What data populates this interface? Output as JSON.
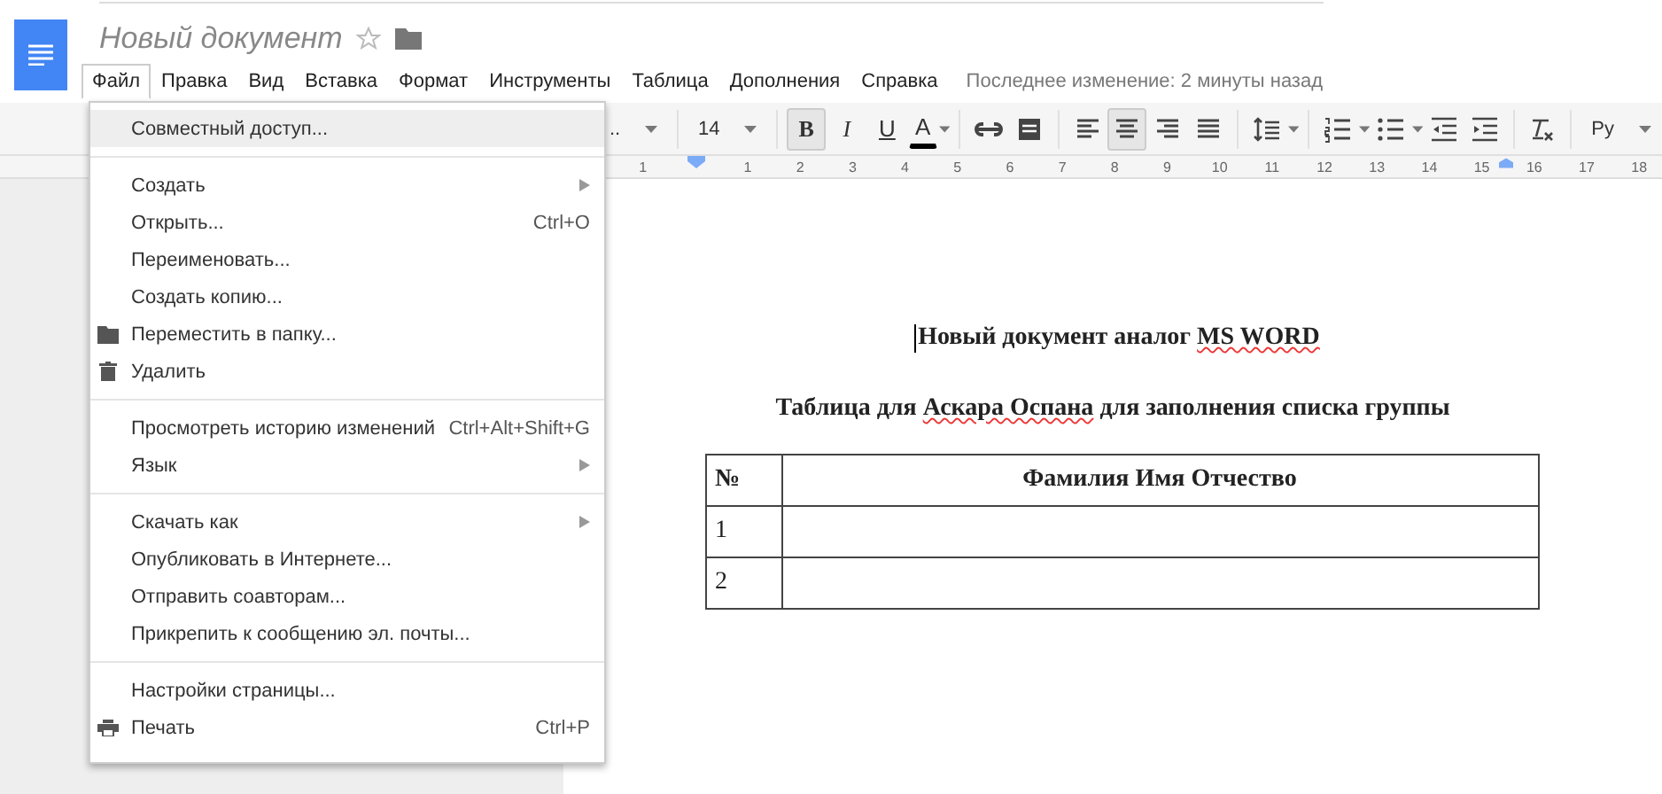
{
  "document_title": "Новый документ",
  "menubar": [
    {
      "label": "Файл",
      "selected": true
    },
    {
      "label": "Правка",
      "selected": false
    },
    {
      "label": "Вид",
      "selected": false
    },
    {
      "label": "Вставка",
      "selected": false
    },
    {
      "label": "Формат",
      "selected": false
    },
    {
      "label": "Инструменты",
      "selected": false
    },
    {
      "label": "Таблица",
      "selected": false
    },
    {
      "label": "Дополнения",
      "selected": false
    },
    {
      "label": "Справка",
      "selected": false
    }
  ],
  "last_edit": "Последнее изменение: 2 минуты назад",
  "toolbar": [
    {
      "kind": "dropdown",
      "label": ".."
    },
    {
      "kind": "separator"
    },
    {
      "kind": "dropdown",
      "label": "14"
    },
    {
      "kind": "separator"
    },
    {
      "kind": "bold",
      "label": "B",
      "selected": true
    },
    {
      "kind": "italic",
      "label": "I",
      "selected": false
    },
    {
      "kind": "underline",
      "label": "U",
      "selected": false
    },
    {
      "kind": "text-color",
      "label": "A",
      "selected": false
    },
    {
      "kind": "separator"
    },
    {
      "kind": "link",
      "selected": false
    },
    {
      "kind": "comment",
      "selected": false
    },
    {
      "kind": "separator"
    },
    {
      "kind": "align-left",
      "selected": false
    },
    {
      "kind": "align-center",
      "selected": true
    },
    {
      "kind": "align-right",
      "selected": false
    },
    {
      "kind": "align-justify",
      "selected": false
    },
    {
      "kind": "separator"
    },
    {
      "kind": "line-spacing",
      "selected": false
    },
    {
      "kind": "separator"
    },
    {
      "kind": "numbered-list",
      "selected": false
    },
    {
      "kind": "bulleted-list",
      "selected": false
    },
    {
      "kind": "indent-less",
      "selected": false
    },
    {
      "kind": "indent-more",
      "selected": false
    },
    {
      "kind": "separator"
    },
    {
      "kind": "clear-format",
      "selected": false
    },
    {
      "kind": "separator"
    },
    {
      "kind": "dropdown",
      "label": "Ру"
    }
  ],
  "ruler": [
    "1",
    "1",
    "2",
    "3",
    "4",
    "5",
    "6",
    "7",
    "8",
    "9",
    "10",
    "11",
    "12",
    "13",
    "14",
    "15",
    "16",
    "17",
    "18"
  ],
  "file_menu": [
    [
      {
        "label": "Совместный доступ...",
        "kind": "plain",
        "highlighted": true
      }
    ],
    [
      {
        "label": "Создать",
        "kind": "plain",
        "submenu": true,
        "highlighted": false
      },
      {
        "label": "Открыть...",
        "kind": "plain",
        "shortcut": "Ctrl+O",
        "highlighted": false
      },
      {
        "label": "Переименовать...",
        "kind": "plain",
        "highlighted": false
      },
      {
        "label": "Создать копию...",
        "kind": "plain",
        "highlighted": false
      },
      {
        "label": "Переместить в папку...",
        "kind": "folder",
        "highlighted": false
      },
      {
        "label": "Удалить",
        "kind": "trash",
        "highlighted": false
      }
    ],
    [
      {
        "label": "Просмотреть историю изменений",
        "kind": "plain",
        "shortcut": "Ctrl+Alt+Shift+G",
        "highlighted": false
      },
      {
        "label": "Язык",
        "kind": "plain",
        "submenu": true,
        "highlighted": false
      }
    ],
    [
      {
        "label": "Скачать как",
        "kind": "plain",
        "submenu": true,
        "highlighted": false
      },
      {
        "label": "Опубликовать в Интернете...",
        "kind": "plain",
        "highlighted": false
      },
      {
        "label": "Отправить соавторам...",
        "kind": "plain",
        "highlighted": false
      },
      {
        "label": "Прикрепить к сообщению эл. почты...",
        "kind": "plain",
        "highlighted": false
      }
    ],
    [
      {
        "label": "Настройки страницы...",
        "kind": "plain",
        "highlighted": false
      },
      {
        "label": "Печать",
        "kind": "printer",
        "shortcut": "Ctrl+P",
        "highlighted": false
      }
    ]
  ],
  "document": {
    "heading": [
      {
        "text": "Новый документ аналог ",
        "misspelled": false
      },
      {
        "text": "MS WORD",
        "misspelled": true
      }
    ],
    "subheading": [
      {
        "text": "Таблица для ",
        "misspelled": false
      },
      {
        "text": "Аскара Оспана",
        "misspelled": true
      },
      {
        "text": " для заполнения списка группы",
        "misspelled": false
      }
    ],
    "table": {
      "columns": [
        "№",
        "Фамилия Имя Отчество"
      ],
      "rows": [
        {
          "number": "1"
        },
        {
          "number": "2"
        }
      ]
    }
  }
}
